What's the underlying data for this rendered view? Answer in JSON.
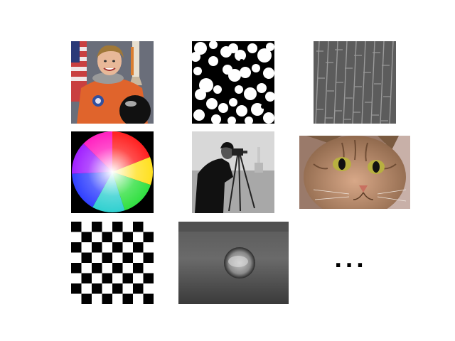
{
  "gallery": {
    "images": [
      {
        "icon": "astronaut-photo-icon",
        "caption": ""
      },
      {
        "icon": "binary-blobs-icon",
        "caption": ""
      },
      {
        "icon": "brick-texture-icon",
        "caption": ""
      },
      {
        "icon": "color-wheel-icon",
        "caption": ""
      },
      {
        "icon": "cameraman-photo-icon",
        "caption": ""
      },
      {
        "icon": "cat-photo-icon",
        "caption": ""
      },
      {
        "icon": "checkerboard-icon",
        "caption": ""
      },
      {
        "icon": "blurred-cell-icon",
        "caption": ""
      }
    ],
    "more_label": "..."
  }
}
